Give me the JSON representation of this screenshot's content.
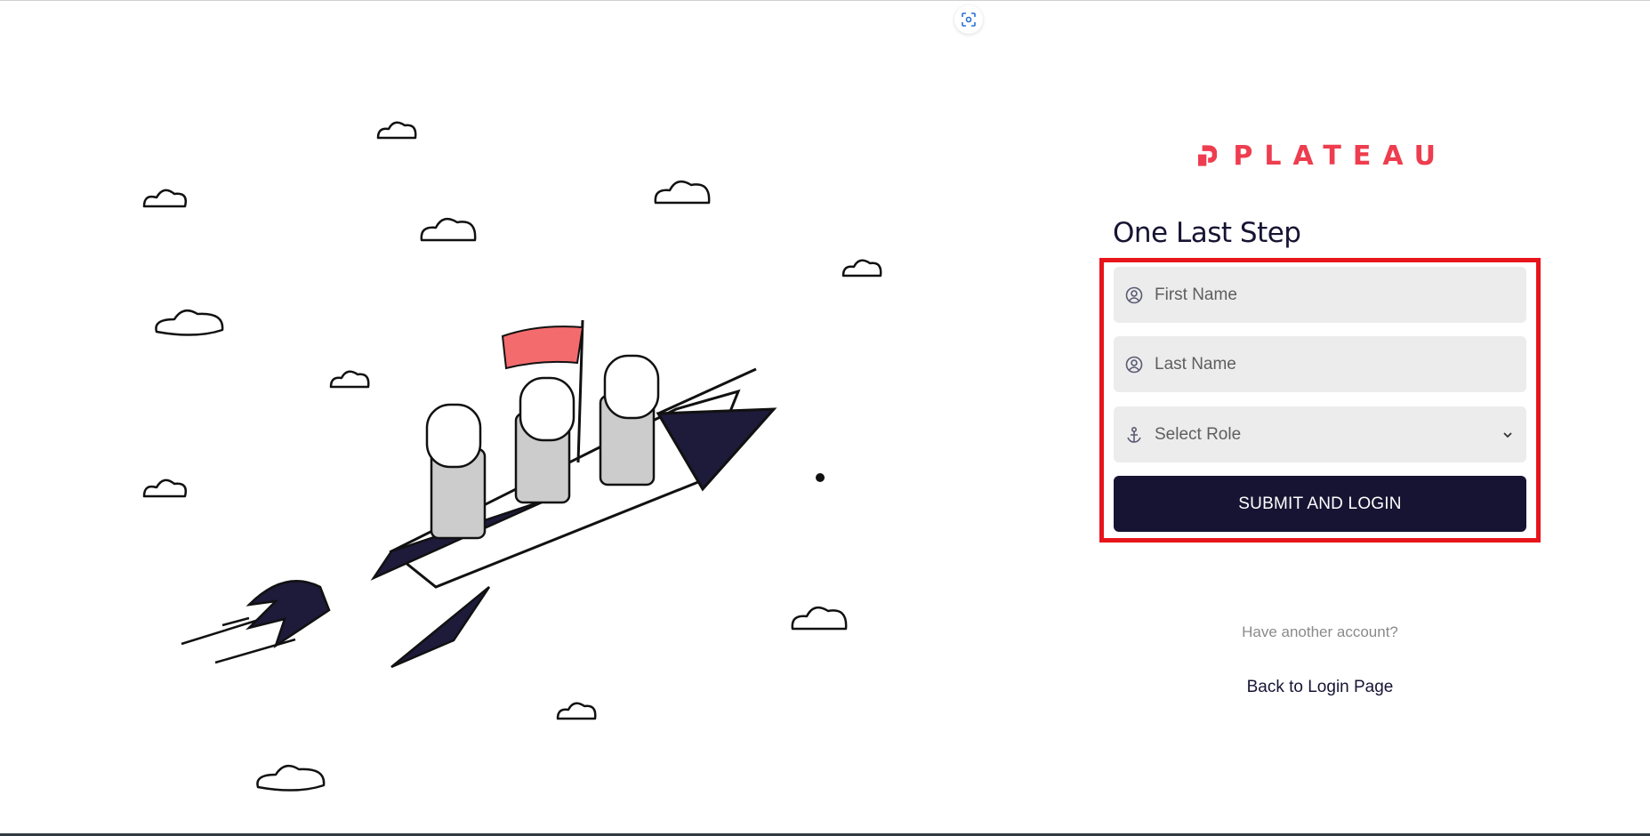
{
  "brand": {
    "name": "PLATEAU",
    "accent_color": "#ee3d4f"
  },
  "toolbar": {
    "screenshot_icon": "screenshot-focus-icon"
  },
  "auth": {
    "heading": "One Last Step",
    "first_name": {
      "placeholder": "First Name",
      "value": "",
      "icon": "user-circle-icon"
    },
    "last_name": {
      "placeholder": "Last Name",
      "value": "",
      "icon": "user-circle-icon"
    },
    "role": {
      "selected_label": "Select Role",
      "icon": "anchor-icon",
      "chevron": "chevron-down-icon"
    },
    "submit_label": "SUBMIT AND LOGIN",
    "other_account_text": "Have another account?",
    "back_link": "Back to Login Page"
  },
  "colors": {
    "primary": "#171433",
    "field_bg": "#ececec",
    "highlight": "#e8141c"
  }
}
